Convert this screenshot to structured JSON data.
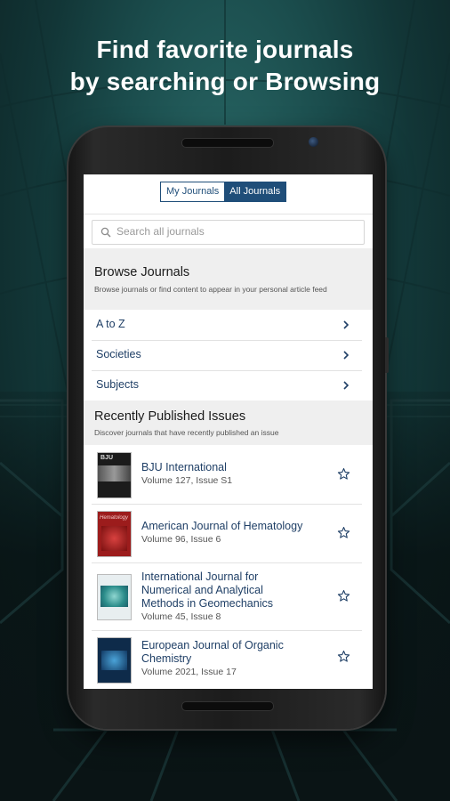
{
  "headline": {
    "line1": "Find favorite journals",
    "line2": "by searching or Browsing"
  },
  "tabs": {
    "my_journals": "My Journals",
    "all_journals": "All Journals",
    "active": "All Journals"
  },
  "search": {
    "placeholder": "Search all journals",
    "value": ""
  },
  "browse": {
    "title": "Browse Journals",
    "subtitle": "Browse journals or find content to appear in your personal article feed",
    "items": [
      {
        "label": "A to Z"
      },
      {
        "label": "Societies"
      },
      {
        "label": "Subjects"
      }
    ]
  },
  "recent": {
    "title": "Recently Published Issues",
    "subtitle": "Discover journals that have recently published an issue",
    "items": [
      {
        "title_lines": [
          "BJU International"
        ],
        "volume": "Volume 127, Issue S1",
        "cover_caption": "BJU"
      },
      {
        "title_lines": [
          "American Journal of Hematology"
        ],
        "volume": "Volume 96, Issue 6",
        "cover_caption": "Hematology"
      },
      {
        "title_lines": [
          "International Journal for",
          "Numerical and Analytical",
          "Methods in Geomechanics"
        ],
        "volume": "Volume 45, Issue 8"
      },
      {
        "title_lines": [
          "European Journal of Organic",
          "Chemistry"
        ],
        "volume": "Volume 2021, Issue 17"
      }
    ]
  },
  "colors": {
    "accent": "#1f4e79",
    "link": "#1f3f66",
    "section_bg": "#efefef"
  },
  "icons": {
    "search": "search-icon",
    "chevron": "chevron-right-icon",
    "favorite": "star-outline-icon"
  }
}
